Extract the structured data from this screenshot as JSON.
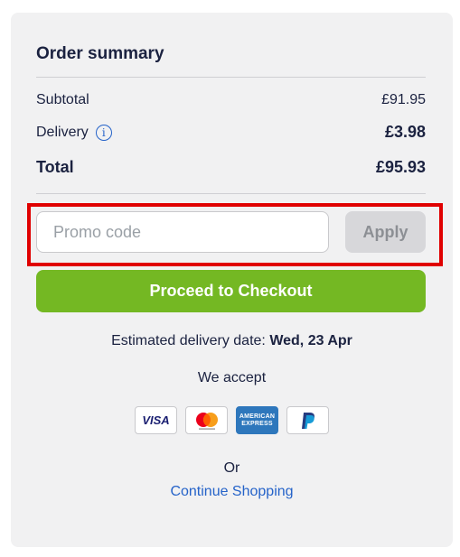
{
  "summary": {
    "title": "Order summary",
    "subtotal_label": "Subtotal",
    "subtotal_value": "£91.95",
    "delivery_label": "Delivery",
    "delivery_value": "£3.98",
    "total_label": "Total",
    "total_value": "£95.93"
  },
  "promo": {
    "placeholder": "Promo code",
    "value": "",
    "apply_label": "Apply"
  },
  "checkout": {
    "button_label": "Proceed to Checkout",
    "delivery_prefix": "Estimated delivery date: ",
    "delivery_date": "Wed, 23 Apr"
  },
  "payments": {
    "heading": "We accept",
    "methods": [
      {
        "name": "visa-icon",
        "label": "VISA"
      },
      {
        "name": "mastercard-icon",
        "label": "mastercard"
      },
      {
        "name": "amex-icon",
        "label": "AMERICAN EXPRESS"
      },
      {
        "name": "paypal-icon",
        "label": "PayPal"
      }
    ]
  },
  "footer": {
    "or_label": "Or",
    "continue_label": "Continue Shopping"
  },
  "colors": {
    "checkout_green": "#74b823",
    "link_blue": "#2563c9",
    "highlight_red": "#e00000",
    "panel_bg": "#f1f1f2"
  }
}
